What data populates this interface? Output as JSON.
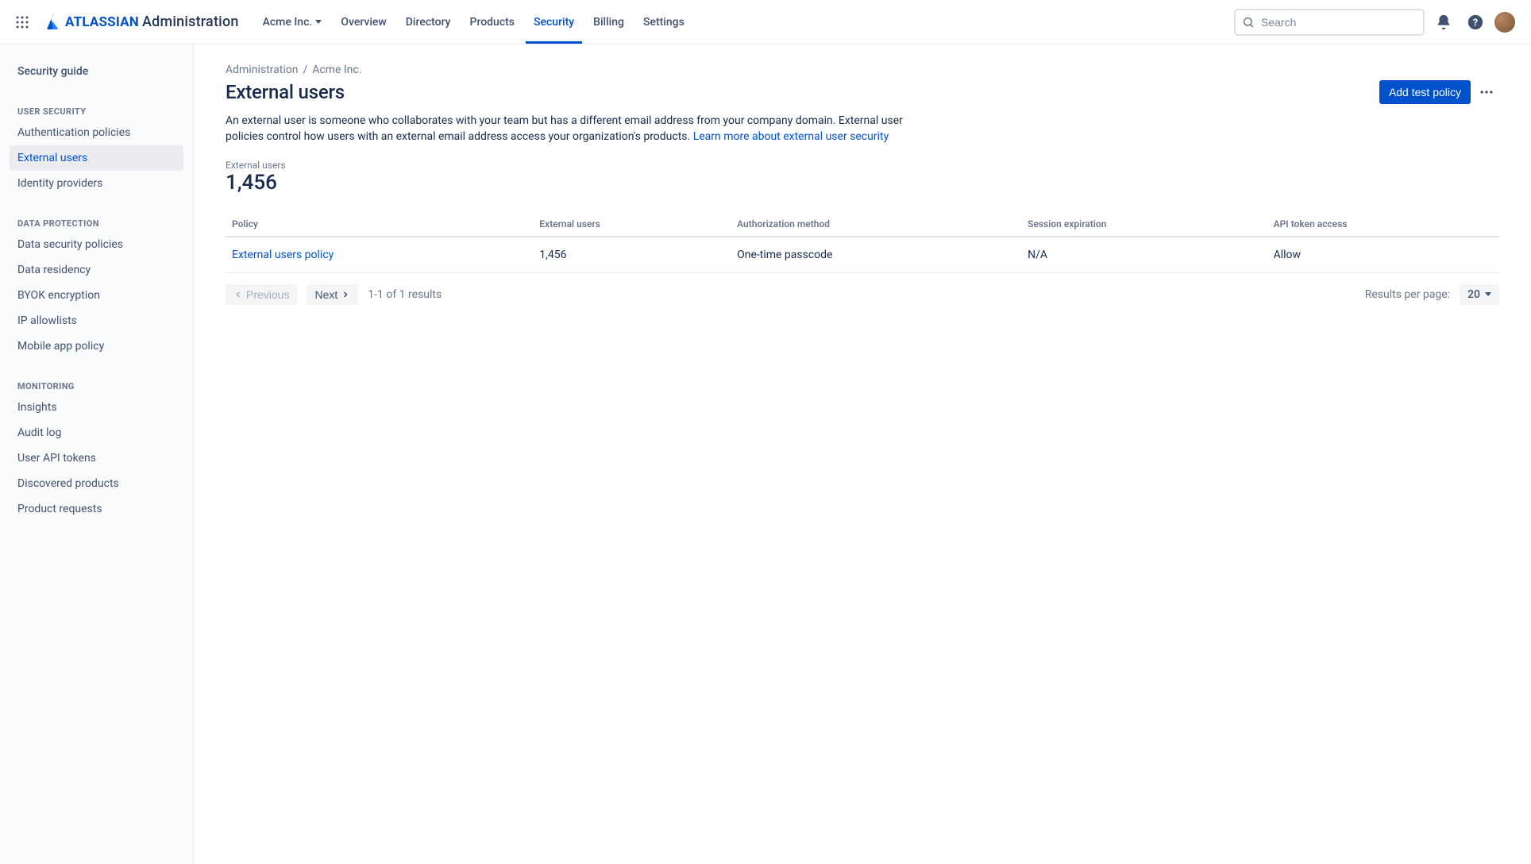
{
  "header": {
    "logo_brand": "ATLASSIAN",
    "logo_product": "Administration",
    "org_selector": "Acme Inc.",
    "nav": [
      "Overview",
      "Directory",
      "Products",
      "Security",
      "Billing",
      "Settings"
    ],
    "active_nav": "Security",
    "search_placeholder": "Search"
  },
  "sidebar": {
    "top_link": "Security guide",
    "groups": [
      {
        "title": "USER SECURITY",
        "items": [
          "Authentication policies",
          "External users",
          "Identity providers"
        ],
        "active": "External users"
      },
      {
        "title": "DATA PROTECTION",
        "items": [
          "Data security policies",
          "Data residency",
          "BYOK encryption",
          "IP allowlists",
          "Mobile app policy"
        ]
      },
      {
        "title": "MONITORING",
        "items": [
          "Insights",
          "Audit log",
          "User API tokens",
          "Discovered products",
          "Product requests"
        ]
      }
    ]
  },
  "breadcrumb": {
    "items": [
      "Administration",
      "Acme Inc."
    ],
    "separator": "/"
  },
  "page": {
    "title": "External users",
    "primary_button": "Add test policy",
    "description_before_link": "An external user is someone who collaborates with your team but has a different email address from your company domain. External user policies control how users with an external email address access your organization's products. ",
    "description_link": "Learn more about external user security",
    "stat_label": "External users",
    "stat_value": "1,456"
  },
  "table": {
    "columns": [
      "Policy",
      "External users",
      "Authorization method",
      "Session expiration",
      "API token access"
    ],
    "rows": [
      {
        "policy": "External users policy",
        "external_users": "1,456",
        "auth_method": "One-time passcode",
        "session_exp": "N/A",
        "api_token": "Allow"
      }
    ]
  },
  "pagination": {
    "prev": "Previous",
    "next": "Next",
    "count_text": "1-1 of 1 results",
    "rpp_label": "Results per page:",
    "rpp_value": "20"
  }
}
